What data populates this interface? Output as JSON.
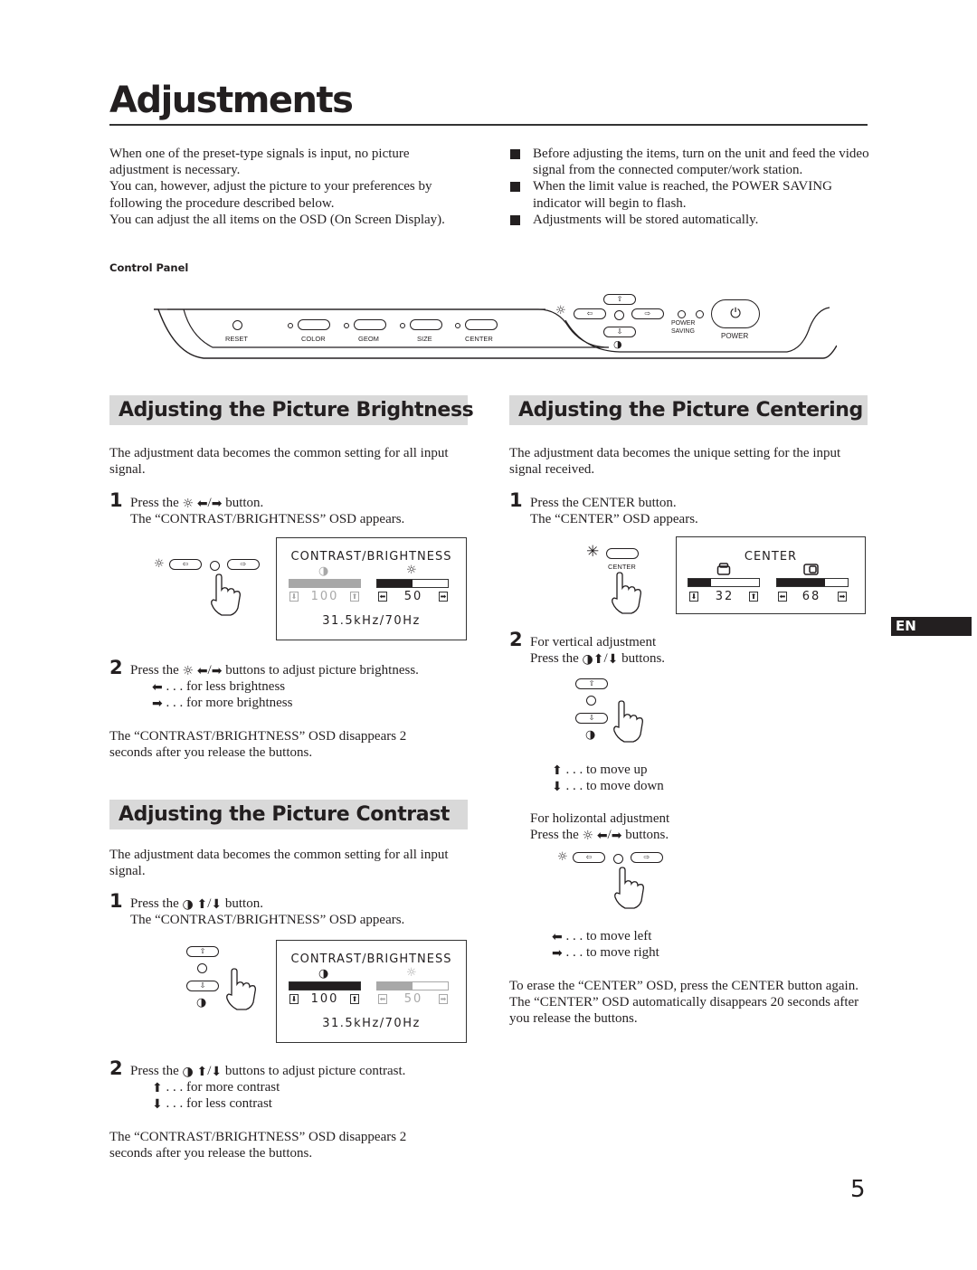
{
  "page": {
    "title": "Adjustments",
    "page_number": "5",
    "language_badge": "EN"
  },
  "intro": {
    "paragraphs": [
      "When one of the preset-type signals is input, no picture adjustment is necessary.",
      "You can, however, adjust the picture to your preferences by following the procedure described below.",
      "You can adjust the all items on the OSD (On Screen Display)."
    ],
    "bullets": [
      "Before adjusting the items, turn on the unit and feed the video signal from the connected computer/work station.",
      "When the limit value is reached, the POWER SAVING indicator will begin to flash.",
      "Adjustments will be stored automatically."
    ]
  },
  "control_panel": {
    "label": "Control Panel",
    "buttons": {
      "reset": "RESET",
      "color": "COLOR",
      "geom": "GEOM",
      "size": "SIZE",
      "center": "CENTER",
      "power_saving_1": "POWER",
      "power_saving_2": "SAVING",
      "power": "POWER"
    },
    "icons": [
      "brightness-icon",
      "arrow-up-icon",
      "arrow-left-icon",
      "arrow-right-icon",
      "arrow-down-icon",
      "contrast-icon",
      "power-icon"
    ]
  },
  "brightness": {
    "heading": "Adjusting the Picture Brightness",
    "intro": "The adjustment data becomes the common setting for all input signal.",
    "step1": {
      "num": "1",
      "line1_pre": "Press the",
      "line1_post": "button.",
      "line2": "The “CONTRAST/BRIGHTNESS” OSD appears."
    },
    "osd": {
      "title": "CONTRAST/BRIGHTNESS",
      "contrast_value": "100",
      "contrast_fraction": 1.0,
      "brightness_value": "50",
      "brightness_fraction": 0.5,
      "active": "brightness",
      "frequency": "31.5kHz/70Hz"
    },
    "step2": {
      "num": "2",
      "line1_pre": "Press the",
      "line1_post": "buttons to adjust picture brightness.",
      "less": ". . . for less brightness",
      "more": ". . . for more brightness"
    },
    "footer": "The “CONTRAST/BRIGHTNESS”  OSD disappears 2 seconds after you release the buttons."
  },
  "contrast": {
    "heading": "Adjusting the Picture Contrast",
    "intro": "The adjustment data becomes the common setting for all input signal.",
    "step1": {
      "num": "1",
      "line1_pre": "Press the",
      "line1_post": "button.",
      "line2": "The “CONTRAST/BRIGHTNESS” OSD appears."
    },
    "osd": {
      "title": "CONTRAST/BRIGHTNESS",
      "contrast_value": "100",
      "contrast_fraction": 1.0,
      "brightness_value": "50",
      "brightness_fraction": 0.5,
      "active": "contrast",
      "frequency": "31.5kHz/70Hz"
    },
    "step2": {
      "num": "2",
      "line1_pre": "Press the",
      "line1_post": "buttons to adjust picture contrast.",
      "more": ". . . for more contrast",
      "less": ". . . for less contrast"
    },
    "footer": "The “CONTRAST/BRIGHTNESS” OSD disappears 2 seconds after you release the buttons."
  },
  "centering": {
    "heading": "Adjusting the Picture Centering",
    "intro": "The adjustment data becomes the unique setting for the input signal received.",
    "step1": {
      "num": "1",
      "line1": "Press the CENTER button.",
      "line2": "The “CENTER” OSD appears.",
      "button_label": "CENTER"
    },
    "osd": {
      "title": "CENTER",
      "vertical_value": "32",
      "vertical_fraction": 0.32,
      "horizontal_value": "68",
      "horizontal_fraction": 0.68
    },
    "step2": {
      "num": "2",
      "vertical_title": "For vertical adjustment",
      "vertical_pre": "Press the",
      "vertical_post": "buttons.",
      "up": ". . . to move up",
      "down": ". . . to move down",
      "horizontal_title": "For holizontal adjustment",
      "horizontal_pre": "Press the",
      "horizontal_post": "buttons.",
      "left": ". . . to move left",
      "right": ". . . to move right"
    },
    "footer1": "To erase the “CENTER” OSD, press the CENTER button again.",
    "footer2": "The “CENTER” OSD automatically disappears 20 seconds after you release the buttons."
  },
  "glyphs": {
    "sun": "☼",
    "contrast": "◑",
    "left": "⬅",
    "right": "➡",
    "up": "⬆",
    "down": "⬇",
    "slash": "/",
    "hollow_up": "⇧",
    "hollow_down": "⇩",
    "hollow_left": "⇦",
    "hollow_right": "⇨",
    "power": "⏻"
  }
}
